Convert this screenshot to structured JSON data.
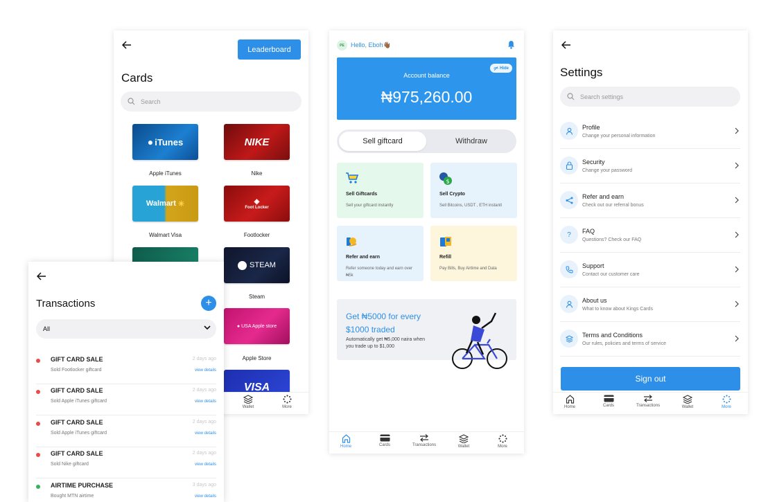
{
  "colors": {
    "accent": "#2d8fe8",
    "dot_red": "#e94b4b",
    "dot_green": "#34b35a"
  },
  "cards_screen": {
    "leaderboard_label": "Leaderboard",
    "title": "Cards",
    "search_placeholder": "Search",
    "cards": [
      {
        "name": "Apple iTunes",
        "logo": "iTunes"
      },
      {
        "name": "Nike",
        "logo": "NIKE"
      },
      {
        "name": "Walmart Visa",
        "logo": "Walmart"
      },
      {
        "name": "Footlocker",
        "logo": "Foot Locker"
      },
      {
        "name": "Steam",
        "logo": "STEAM"
      },
      {
        "name": "Apple Store",
        "logo": "USA Apple store"
      },
      {
        "name": "",
        "logo": "VISA"
      }
    ],
    "nav": [
      {
        "label": "Wallet"
      },
      {
        "label": "More"
      }
    ]
  },
  "transactions_screen": {
    "title": "Transactions",
    "add_label": "+",
    "filter_value": "All",
    "items": [
      {
        "title": "GIFT CARD SALE",
        "subtitle": "Sold Footlocker giftcard",
        "time": "2 days ago",
        "link": "view details",
        "status": "red"
      },
      {
        "title": "GIFT CARD SALE",
        "subtitle": "Sold Apple iTunes giftcard",
        "time": "2 days ago",
        "link": "view details",
        "status": "red"
      },
      {
        "title": "GIFT CARD SALE",
        "subtitle": "Sold Apple iTunes giftcard",
        "time": "2 days ago",
        "link": "view details",
        "status": "red"
      },
      {
        "title": "GIFT CARD SALE",
        "subtitle": "Sold Nike giftcard",
        "time": "2 days ago",
        "link": "view details",
        "status": "red"
      },
      {
        "title": "AIRTIME PURCHASE",
        "subtitle": "Bought MTN airtime",
        "time": "3 days ago",
        "link": "view details",
        "status": "green"
      }
    ]
  },
  "home_screen": {
    "avatar_initials": "PE",
    "greeting": "Hello, Eboh👋🏾",
    "hide_label": "Hide",
    "balance_label": "Account balance",
    "balance_value": "₦975,260.00",
    "segment_active": "Sell giftcard",
    "segment_inactive": "Withdraw",
    "tiles": [
      {
        "title": "Sell Giftcards",
        "desc": "Sell your giftcard instantly"
      },
      {
        "title": "Sell Crypto",
        "desc": "Sell Bitcoins, USDT , ETH instantl"
      },
      {
        "title": "Refer and earn",
        "desc": "Refer someone today and earn over ₦5k"
      },
      {
        "title": "Refill",
        "desc": "Pay Bills, Buy Airtime and Data"
      }
    ],
    "promo_title": "Get ₦5000 for every $1000 traded",
    "promo_desc": "Automatically get ₦5,000 naira when you trade up to $1,000",
    "nav": [
      {
        "label": "Home"
      },
      {
        "label": "Cards"
      },
      {
        "label": "Transactions"
      },
      {
        "label": "Wallet"
      },
      {
        "label": "More"
      }
    ]
  },
  "settings_screen": {
    "title": "Settings",
    "search_placeholder": "Search settings",
    "items": [
      {
        "title": "Profile",
        "subtitle": "Change your personal information",
        "icon": "user-icon"
      },
      {
        "title": "Security",
        "subtitle": "Change your password",
        "icon": "lock-icon"
      },
      {
        "title": "Refer and earn",
        "subtitle": "Check out our referral bonus",
        "icon": "share-icon"
      },
      {
        "title": "FAQ",
        "subtitle": "Questions? Check our FAQ",
        "icon": "question-icon"
      },
      {
        "title": "Support",
        "subtitle": "Contact our customer care",
        "icon": "phone-icon"
      },
      {
        "title": "About us",
        "subtitle": "What to know about Kings Cards",
        "icon": "user-icon"
      },
      {
        "title": "Terms and Conditions",
        "subtitle": "Our rules, policies and terms of service",
        "icon": "layers-icon"
      }
    ],
    "signout_label": "Sign out",
    "nav": [
      {
        "label": "Home"
      },
      {
        "label": "Cards"
      },
      {
        "label": "Transactions"
      },
      {
        "label": "Wallet"
      },
      {
        "label": "More"
      }
    ]
  }
}
